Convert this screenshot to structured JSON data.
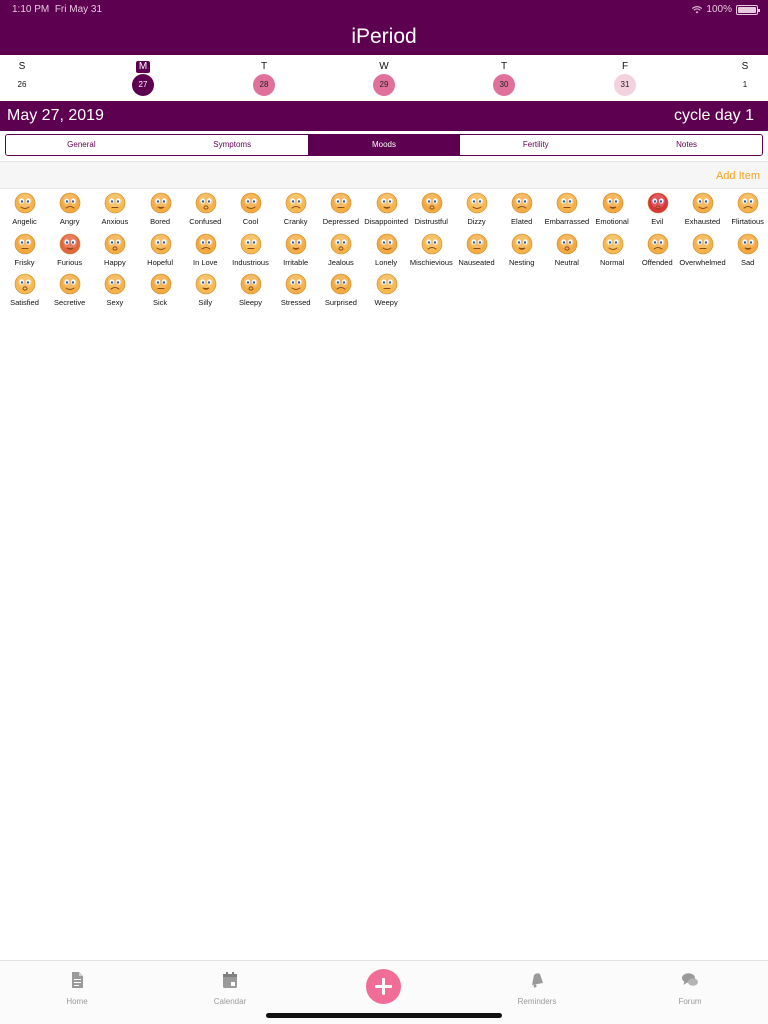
{
  "status": {
    "time": "1:10 PM",
    "date": "Fri May 31",
    "battery": "100%",
    "battery_level": 1.0
  },
  "app": {
    "title": "iPeriod"
  },
  "week": [
    {
      "letter": "S",
      "num": "26",
      "state": "none"
    },
    {
      "letter": "M",
      "num": "27",
      "state": "selected"
    },
    {
      "letter": "T",
      "num": "28",
      "state": "period"
    },
    {
      "letter": "W",
      "num": "29",
      "state": "period"
    },
    {
      "letter": "T",
      "num": "30",
      "state": "period"
    },
    {
      "letter": "F",
      "num": "31",
      "state": "light"
    },
    {
      "letter": "S",
      "num": "1",
      "state": "none"
    }
  ],
  "datebar": {
    "date": "May 27, 2019",
    "cycle": "cycle day 1"
  },
  "tabs": [
    {
      "label": "General",
      "active": false
    },
    {
      "label": "Symptoms",
      "active": false
    },
    {
      "label": "Moods",
      "active": true
    },
    {
      "label": "Fertility",
      "active": false
    },
    {
      "label": "Notes",
      "active": false
    }
  ],
  "add_item": "Add Item",
  "moods": [
    "Angelic",
    "Angry",
    "Anxious",
    "Bored",
    "Confused",
    "Cool",
    "Cranky",
    "Depressed",
    "Disappointed",
    "Distrustful",
    "Dizzy",
    "Elated",
    "Embarrassed",
    "Emotional",
    "Evil",
    "Exhausted",
    "Flirtatious",
    "Frisky",
    "Furious",
    "Happy",
    "Hopeful",
    "In Love",
    "Industrious",
    "Irritable",
    "Jealous",
    "Lonely",
    "Mischievious",
    "Nauseated",
    "Nesting",
    "Neutral",
    "Normal",
    "Offended",
    "Overwhelmed",
    "Sad",
    "Satisfied",
    "Secretive",
    "Sexy",
    "Sick",
    "Silly",
    "Sleepy",
    "Stressed",
    "Surprised",
    "Weepy"
  ],
  "mood_icons": [
    "emoji-face-icon"
  ],
  "colors": {
    "brand": "#5e0050",
    "period": "#e0719a",
    "predicted": "#f2d2de",
    "accent": "#f6a21c",
    "plus": "#ef6d96"
  },
  "nav": [
    {
      "label": "Home",
      "icon": "document-icon"
    },
    {
      "label": "Calendar",
      "icon": "calendar-icon"
    },
    {
      "label": "Reminders",
      "icon": "bell-icon"
    },
    {
      "label": "Forum",
      "icon": "chat-bubbles-icon"
    }
  ]
}
